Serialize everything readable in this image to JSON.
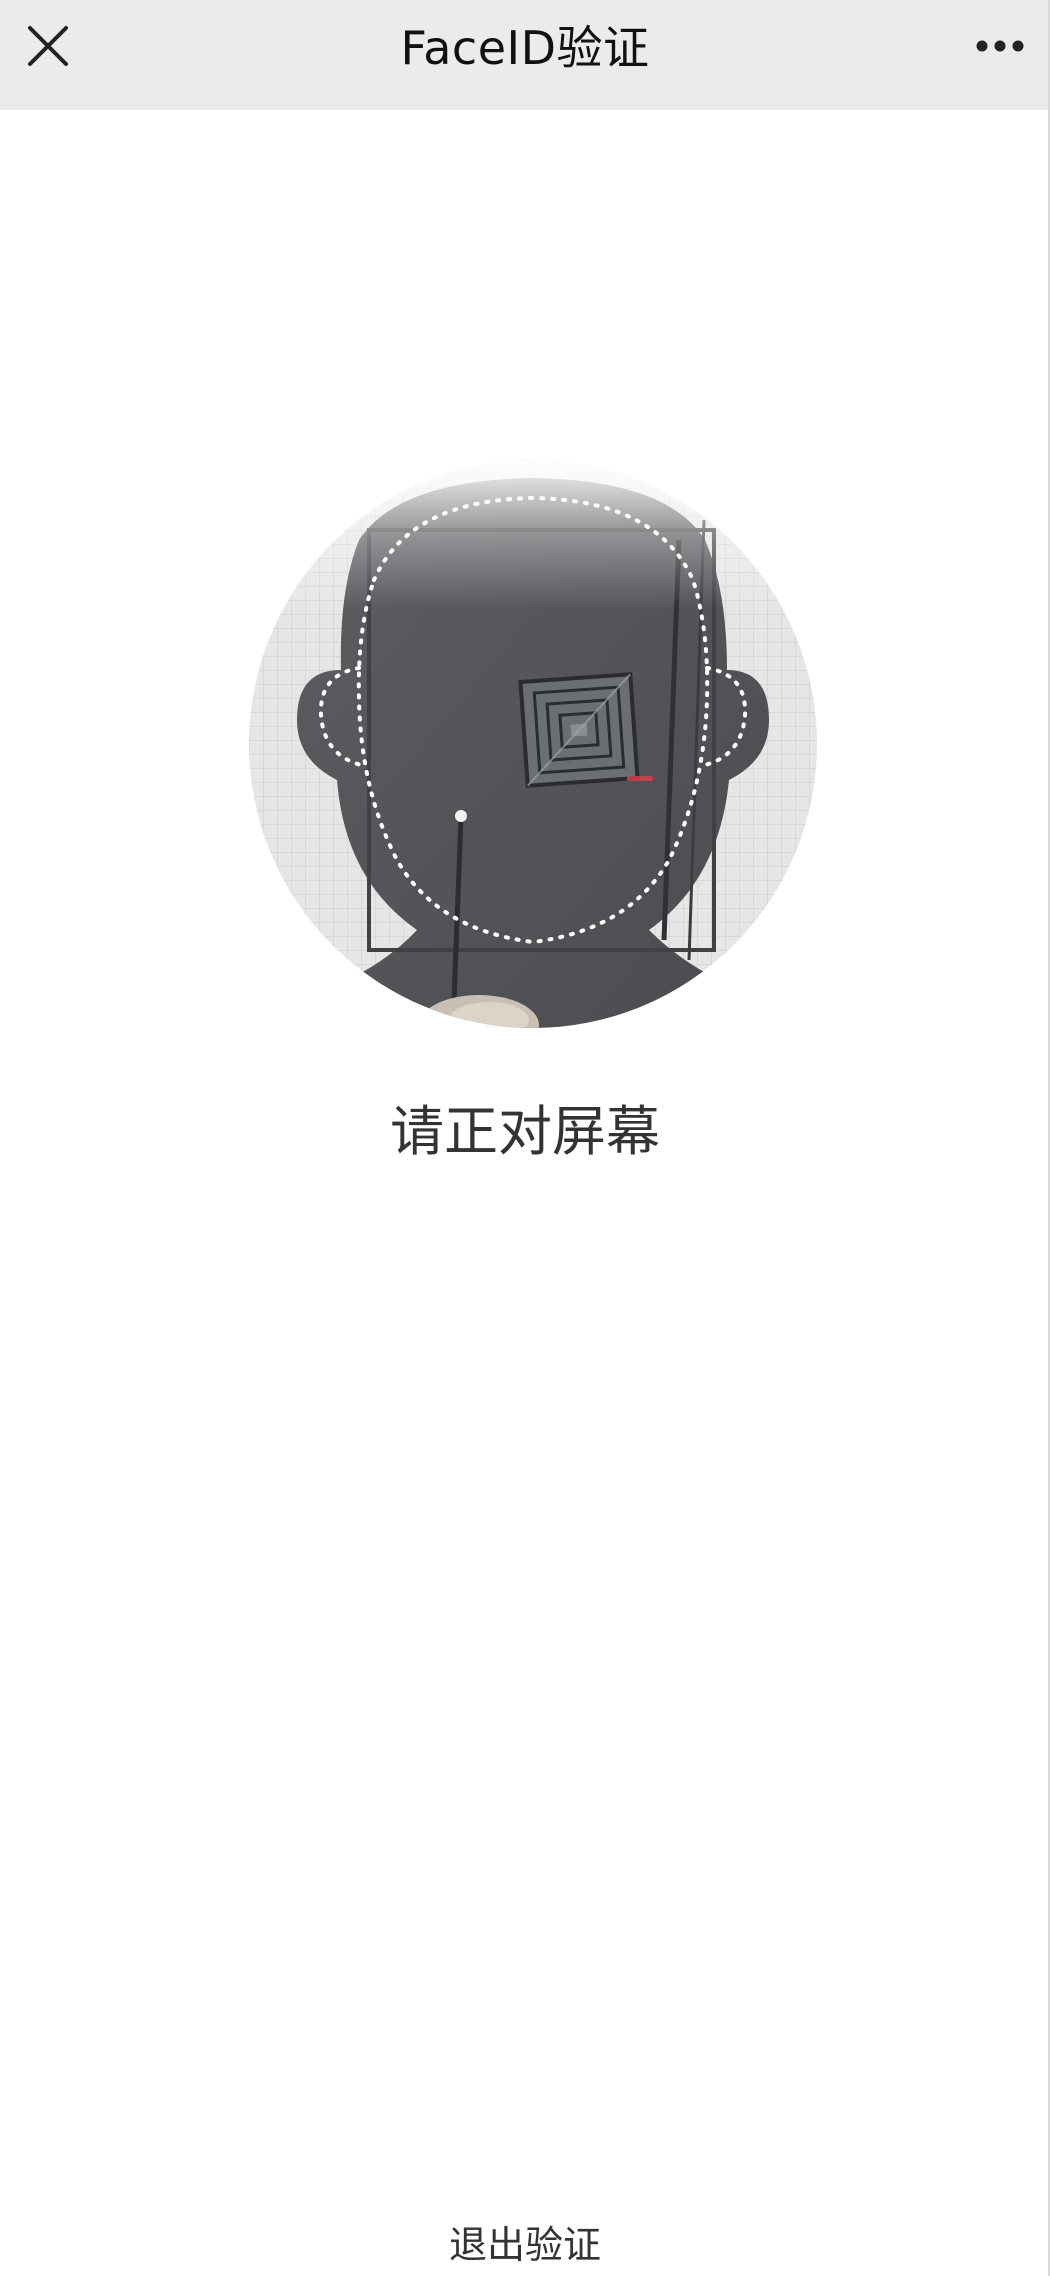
{
  "navbar": {
    "title": "FaceID验证",
    "close_icon": "close-icon",
    "more_icon": "more-icon"
  },
  "camera": {
    "description_icon": "face-outline-overlay"
  },
  "prompt": {
    "text": "请正对屏幕"
  },
  "footer": {
    "exit_label": "退出验证"
  },
  "colors": {
    "navbar_bg": "#ebebeb",
    "text_primary": "#111111",
    "text_secondary": "#333333",
    "overlay_grid": "#e3e3e3"
  }
}
